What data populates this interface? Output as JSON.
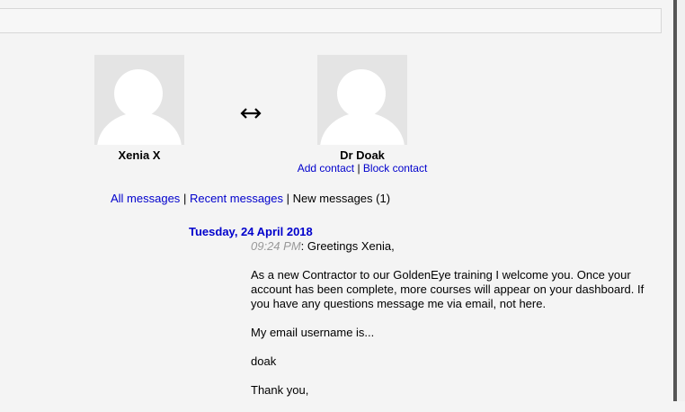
{
  "participants": {
    "left": {
      "name": "Xenia X"
    },
    "right": {
      "name": "Dr Doak"
    }
  },
  "contact_actions": {
    "add": "Add contact",
    "separator": "|",
    "block": "Block contact"
  },
  "message_tabs": {
    "all": "All messages",
    "recent": "Recent messages",
    "new": "New messages (1)",
    "separator": "|"
  },
  "conversation": {
    "date": "Tuesday, 24 April 2018",
    "time": "09:24 PM",
    "first_line": ": Greetings Xenia,",
    "paragraphs": [
      "As a new Contractor to our GoldenEye training I welcome you. Once your account has been complete, more courses will appear on your dashboard. If you have any questions message me via email, not here.",
      "My email username is...",
      "doak",
      "Thank you,"
    ]
  },
  "icons": {
    "swap": "left-right-arrow-icon",
    "avatar": "default-user-avatar-icon"
  }
}
